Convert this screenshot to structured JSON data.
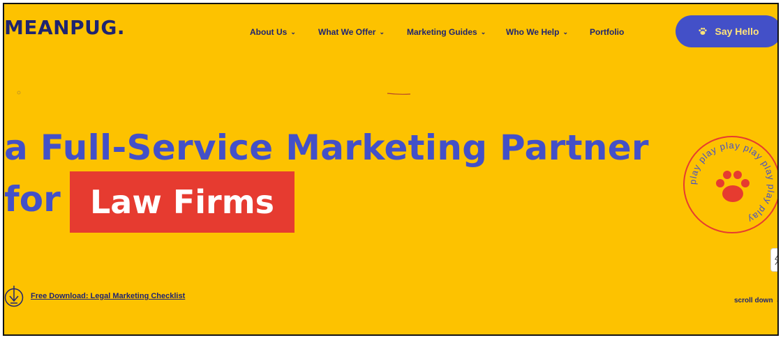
{
  "brand": {
    "logo_text": "MEANPUG.",
    "colors": {
      "background": "#fdc200",
      "primary": "#4350c8",
      "navy": "#1f2470",
      "accent_red": "#e63b30",
      "cta_text": "#ffe37a"
    }
  },
  "nav": {
    "items": [
      {
        "label": "About Us",
        "has_dropdown": true
      },
      {
        "label": "What We Offer",
        "has_dropdown": true
      },
      {
        "label": "Marketing Guides",
        "has_dropdown": true
      },
      {
        "label": "Who We Help",
        "has_dropdown": true
      },
      {
        "label": "Portfolio",
        "has_dropdown": false
      }
    ],
    "chevron_glyph": "⌄"
  },
  "cta": {
    "label": "Say Hello",
    "icon": "paw-icon"
  },
  "hero": {
    "line1": "a Full-Service Marketing Partner",
    "line2_prefix": "for",
    "highlight": "Law Firms"
  },
  "play_badge": {
    "ring_text": "play play play play play play play ",
    "icon": "paw-icon"
  },
  "download": {
    "label": "Free Download: Legal Marketing Checklist",
    "icon": "download-arrow-icon"
  },
  "scroll": {
    "label": "scroll down",
    "chevron_glyph": "⌄"
  }
}
